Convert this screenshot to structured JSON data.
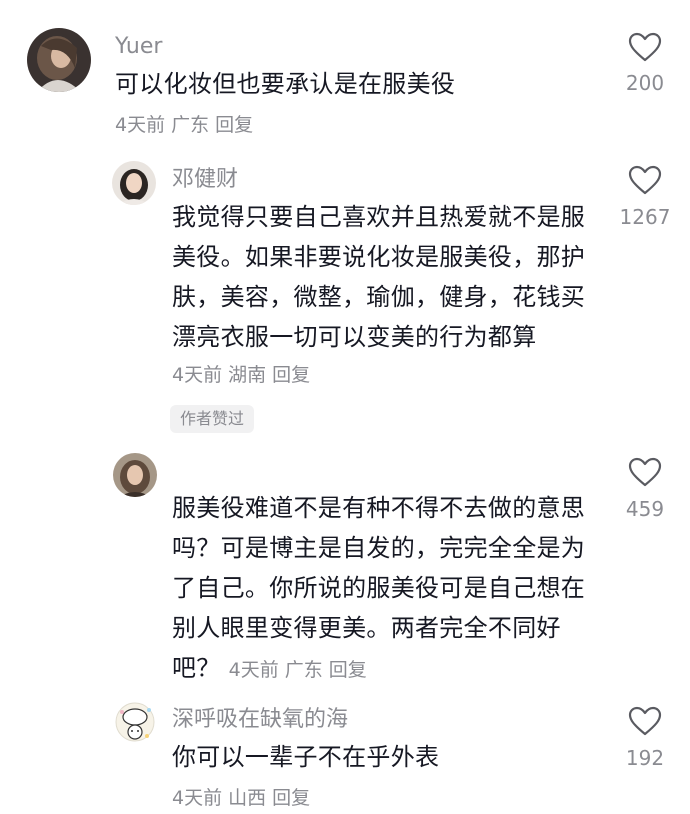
{
  "comments": [
    {
      "username": "Yuer",
      "content": "可以化妆但也要承认是在服美役",
      "time": "4天前",
      "location": "广东",
      "reply_label": "回复",
      "likes": "200"
    },
    {
      "username": "邓健财",
      "content_lines": [
        "我觉得只要自己喜欢并且热爱就不是服",
        "美役。如果非要说化妆是服美役，那护",
        "肤，美容，微整，瑜伽，健身，花钱买",
        "漂亮衣服一切可以变美的行为都算"
      ],
      "time": "4天前",
      "location": "湖南",
      "reply_label": "回复",
      "author_badge": "作者赞过",
      "likes": "1267"
    },
    {
      "username": "",
      "content_lines": [
        "服美役难道不是有种不得不去做的意思",
        "吗？可是博主是自发的，完完全全是为",
        "了自己。你所说的服美役可是自己想在",
        "别人眼里变得更美。两者完全不同好",
        "吧？"
      ],
      "time": "4天前",
      "location": "广东",
      "reply_label": "回复",
      "likes": "459"
    },
    {
      "username": "深呼吸在缺氧的海",
      "content": "你可以一辈子不在乎外表",
      "time": "4天前",
      "location": "山西",
      "reply_label": "回复",
      "likes": "192"
    }
  ],
  "icons": {
    "like": "heart-outline-icon"
  },
  "colors": {
    "text": "#161823",
    "secondary": "#8a8b91",
    "badge_bg": "#f1f1f2"
  }
}
